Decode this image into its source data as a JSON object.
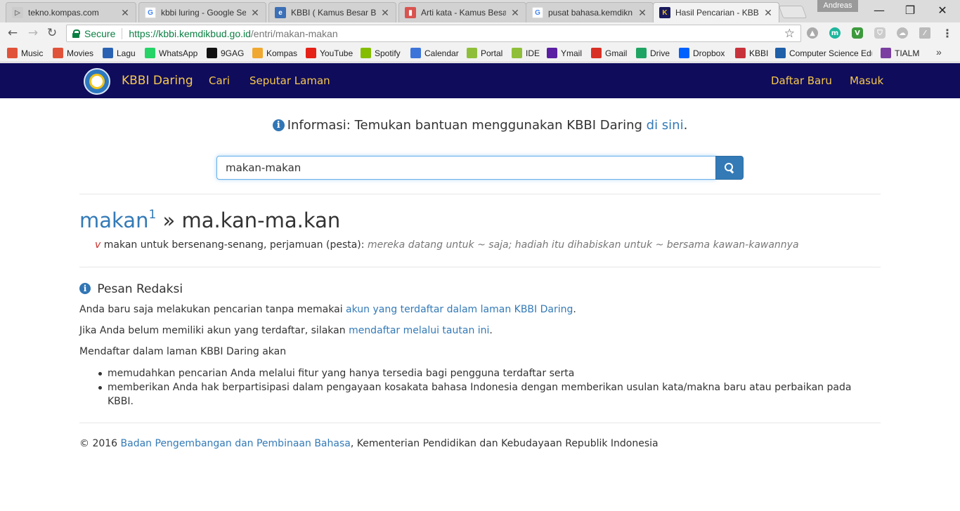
{
  "browser": {
    "tabs": [
      {
        "label": "tekno.kompas.com",
        "favicon": "kompas-favicon"
      },
      {
        "label": "kbbi luring - Google Se",
        "favicon": "google-favicon"
      },
      {
        "label": "KBBI ( Kamus Besar Bal",
        "favicon": "kbbi-favicon"
      },
      {
        "label": "Arti kata - Kamus Besa",
        "favicon": "book-favicon"
      },
      {
        "label": "pusat bahasa.kemdikn",
        "favicon": "google-favicon"
      },
      {
        "label": "Hasil Pencarian - KBBI",
        "favicon": "kbbi-k-favicon"
      }
    ],
    "profile_name": "Andreas",
    "window_controls": {
      "minimize": "—",
      "restore": "❐",
      "close": "✕"
    },
    "omnibox": {
      "secure_label": "Secure",
      "url_base": "https://kbbi.kemdikbud.go.id",
      "url_path": "/entri/makan-makan"
    },
    "bookmarks": [
      {
        "label": "Music",
        "icon": "music-icon",
        "color": "#e0533a"
      },
      {
        "label": "Movies",
        "icon": "movies-icon",
        "color": "#e0533a"
      },
      {
        "label": "Lagu",
        "icon": "lagu-icon",
        "color": "#2a62b3"
      },
      {
        "label": "WhatsApp",
        "icon": "whatsapp-icon",
        "color": "#25d366"
      },
      {
        "label": "9GAG",
        "icon": "9gag-icon",
        "color": "#111111"
      },
      {
        "label": "Kompas",
        "icon": "kompas-icon",
        "color": "#f0a830"
      },
      {
        "label": "YouTube",
        "icon": "youtube-icon",
        "color": "#e62117"
      },
      {
        "label": "Spotify",
        "icon": "spotify-icon",
        "color": "#84bd00"
      },
      {
        "label": "Calendar",
        "icon": "calendar-icon",
        "color": "#3d74d9"
      },
      {
        "label": "Portal",
        "icon": "portal-icon",
        "color": "#8fbf3a"
      },
      {
        "label": "IDE",
        "icon": "ide-icon",
        "color": "#8fbf3a"
      },
      {
        "label": "Ymail",
        "icon": "ymail-icon",
        "color": "#5a1fa2"
      },
      {
        "label": "Gmail",
        "icon": "gmail-icon",
        "color": "#d93025"
      },
      {
        "label": "Drive",
        "icon": "drive-icon",
        "color": "#1fa463"
      },
      {
        "label": "Dropbox",
        "icon": "dropbox-icon",
        "color": "#0061fe"
      },
      {
        "label": "KBBI",
        "icon": "kbbi-icon",
        "color": "#c8333b"
      },
      {
        "label": "Computer Science Edu",
        "icon": "cs-icon",
        "color": "#1e5fa8"
      },
      {
        "label": "TIALM",
        "icon": "tialm-icon",
        "color": "#7a3fa0"
      }
    ],
    "bookmarks_overflow": "»"
  },
  "site": {
    "brand": "KBBI Daring",
    "nav_left": [
      "Cari",
      "Seputar Laman"
    ],
    "nav_right": [
      "Daftar Baru",
      "Masuk"
    ],
    "navbar_color": "#0f0c5c",
    "link_color": "#f7c94a"
  },
  "info": {
    "icon": "info-circle-icon",
    "prefix": "Informasi: Temukan bantuan menggunakan KBBI Daring ",
    "link": "di sini",
    "suffix": "."
  },
  "search": {
    "value": "makan-makan",
    "button_icon": "search-icon"
  },
  "entry": {
    "root": "makan",
    "root_sup": "1",
    "separator": " » ",
    "headword": "ma.kan-ma.kan",
    "pos": "v",
    "meaning": "makan untuk bersenang-senang, perjamuan (pesta):",
    "example": "mereka datang untuk ~ saja; hadiah itu dihabiskan untuk ~ bersama kawan-kawannya"
  },
  "message": {
    "title": "Pesan Redaksi",
    "p1_text": "Anda baru saja melakukan pencarian tanpa memakai ",
    "p1_link": "akun yang terdaftar dalam laman KBBI Daring",
    "p1_end": ".",
    "p2_text": "Jika Anda belum memiliki akun yang terdaftar, silakan ",
    "p2_link": "mendaftar melalui tautan ini",
    "p2_end": ".",
    "p3_text": "Mendaftar dalam laman KBBI Daring akan",
    "bullets": [
      "memudahkan pencarian Anda melalui fitur yang hanya tersedia bagi pengguna terdaftar serta",
      "memberikan Anda hak berpartisipasi dalam pengayaan kosakata bahasa Indonesia dengan memberikan usulan kata/makna baru atau perbaikan pada KBBI."
    ]
  },
  "footer": {
    "prefix": "© 2016 ",
    "link": "Badan Pengembangan dan Pembinaan Bahasa",
    "suffix": ", Kementerian Pendidikan dan Kebudayaan Republik Indonesia"
  }
}
